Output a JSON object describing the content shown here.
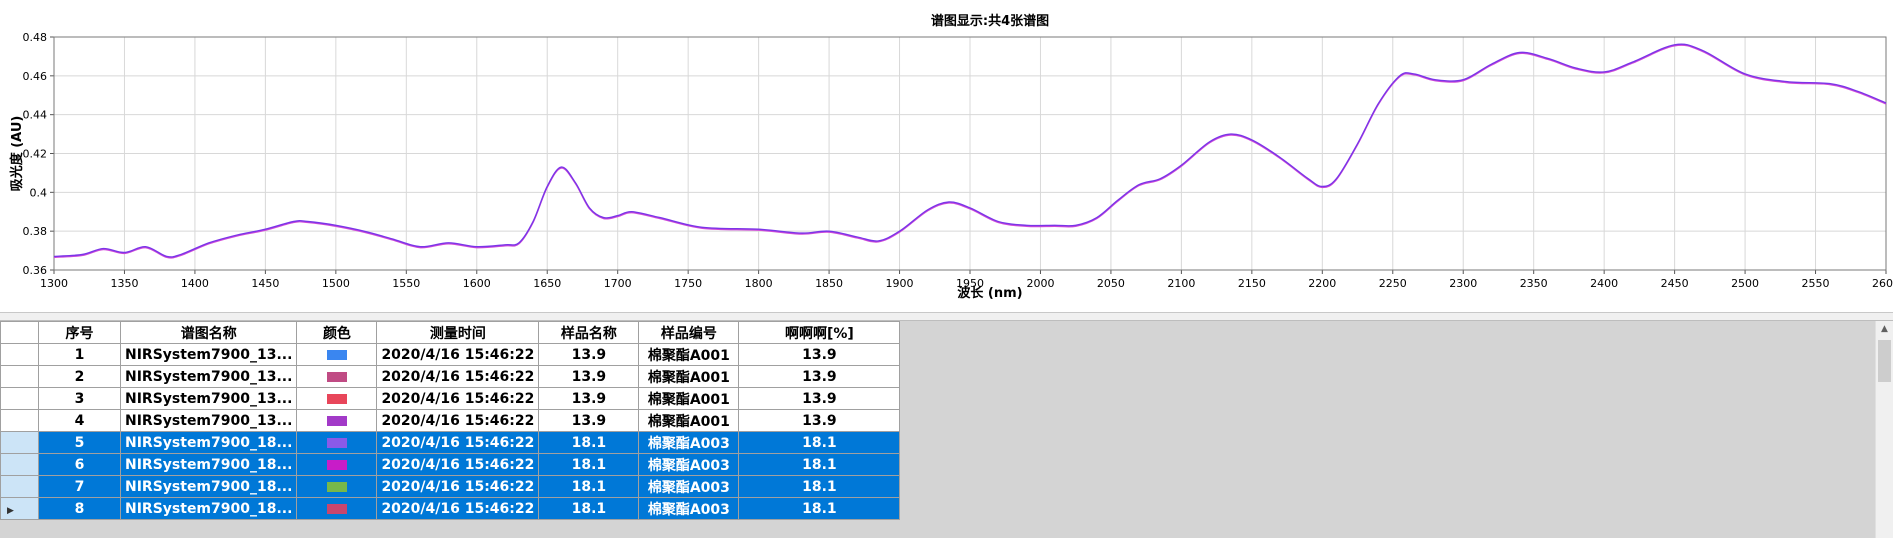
{
  "chart_data": {
    "type": "line",
    "title": "谱图显示:共4张谱图",
    "xlabel": "波长 (nm)",
    "ylabel": "吸光度 (AU)",
    "xlim": [
      1300,
      2600
    ],
    "ylim": [
      0.36,
      0.48
    ],
    "xticks": [
      "1300",
      "1350",
      "1400",
      "1450",
      "1500",
      "1550",
      "1600",
      "1650",
      "1700",
      "1750",
      "1800",
      "1850",
      "1900",
      "1950",
      "2000",
      "2050",
      "2100",
      "2150",
      "2200",
      "2250",
      "2300",
      "2350",
      "2400",
      "2450",
      "2500",
      "2550",
      "2600"
    ],
    "yticks": [
      "0.36",
      "0.38",
      "0.4",
      "0.42",
      "0.44",
      "0.46",
      "0.48"
    ],
    "grid": true,
    "series": [
      {
        "color": "#7b35e8",
        "x": [
          1300,
          1320,
          1335,
          1350,
          1365,
          1380,
          1390,
          1410,
          1430,
          1450,
          1470,
          1480,
          1500,
          1520,
          1540,
          1560,
          1580,
          1600,
          1620,
          1630,
          1640,
          1650,
          1660,
          1670,
          1680,
          1690,
          1700,
          1710,
          1730,
          1760,
          1800,
          1830,
          1850,
          1870,
          1885,
          1900,
          1920,
          1935,
          1950,
          1970,
          1990,
          2010,
          2025,
          2040,
          2055,
          2070,
          2085,
          2100,
          2120,
          2135,
          2150,
          2170,
          2190,
          2200,
          2210,
          2225,
          2240,
          2255,
          2265,
          2280,
          2300,
          2320,
          2340,
          2360,
          2380,
          2400,
          2420,
          2450,
          2470,
          2500,
          2530,
          2560,
          2580,
          2600
        ],
        "y": [
          0.367,
          0.368,
          0.371,
          0.369,
          0.372,
          0.367,
          0.368,
          0.374,
          0.378,
          0.381,
          0.385,
          0.385,
          0.383,
          0.38,
          0.376,
          0.372,
          0.374,
          0.372,
          0.373,
          0.374,
          0.385,
          0.403,
          0.413,
          0.405,
          0.392,
          0.387,
          0.388,
          0.39,
          0.387,
          0.382,
          0.381,
          0.379,
          0.38,
          0.377,
          0.375,
          0.38,
          0.391,
          0.395,
          0.392,
          0.385,
          0.383,
          0.383,
          0.383,
          0.387,
          0.396,
          0.404,
          0.407,
          0.414,
          0.426,
          0.43,
          0.427,
          0.418,
          0.407,
          0.403,
          0.407,
          0.425,
          0.446,
          0.46,
          0.461,
          0.458,
          0.458,
          0.466,
          0.472,
          0.469,
          0.464,
          0.462,
          0.467,
          0.476,
          0.473,
          0.461,
          0.457,
          0.456,
          0.452,
          0.446
        ]
      }
    ]
  },
  "table": {
    "headers": [
      "序号",
      "谱图名称",
      "颜色",
      "测量时间",
      "样品名称",
      "样品编号",
      "啊啊啊[%]"
    ],
    "rows": [
      {
        "no": "1",
        "name": "NIRSystem7900_13...",
        "color": "#3a86f0",
        "time": "2020/4/16 15:46:22",
        "sample": "13.9",
        "code": "棉聚酯A001",
        "value": "13.9",
        "selected": false
      },
      {
        "no": "2",
        "name": "NIRSystem7900_13...",
        "color": "#c04b84",
        "time": "2020/4/16 15:46:22",
        "sample": "13.9",
        "code": "棉聚酯A001",
        "value": "13.9",
        "selected": false
      },
      {
        "no": "3",
        "name": "NIRSystem7900_13...",
        "color": "#e8465a",
        "time": "2020/4/16 15:46:22",
        "sample": "13.9",
        "code": "棉聚酯A001",
        "value": "13.9",
        "selected": false
      },
      {
        "no": "4",
        "name": "NIRSystem7900_13...",
        "color": "#a23ac8",
        "time": "2020/4/16 15:46:22",
        "sample": "13.9",
        "code": "棉聚酯A001",
        "value": "13.9",
        "selected": false
      },
      {
        "no": "5",
        "name": "NIRSystem7900_18...",
        "color": "#8a5ae8",
        "time": "2020/4/16 15:46:22",
        "sample": "18.1",
        "code": "棉聚酯A003",
        "value": "18.1",
        "selected": true
      },
      {
        "no": "6",
        "name": "NIRSystem7900_18...",
        "color": "#c81cc8",
        "time": "2020/4/16 15:46:22",
        "sample": "18.1",
        "code": "棉聚酯A003",
        "value": "18.1",
        "selected": true
      },
      {
        "no": "7",
        "name": "NIRSystem7900_18...",
        "color": "#76b84a",
        "time": "2020/4/16 15:46:22",
        "sample": "18.1",
        "code": "棉聚酯A003",
        "value": "18.1",
        "selected": true
      },
      {
        "no": "8",
        "name": "NIRSystem7900_18...",
        "color": "#c8466e",
        "time": "2020/4/16 15:46:22",
        "sample": "18.1",
        "code": "棉聚酯A003",
        "value": "18.1",
        "selected": true
      }
    ]
  },
  "colors": {
    "selection": "#0078d7",
    "selection_header": "#cce4f7",
    "grid_background": "#d4d4d4"
  }
}
